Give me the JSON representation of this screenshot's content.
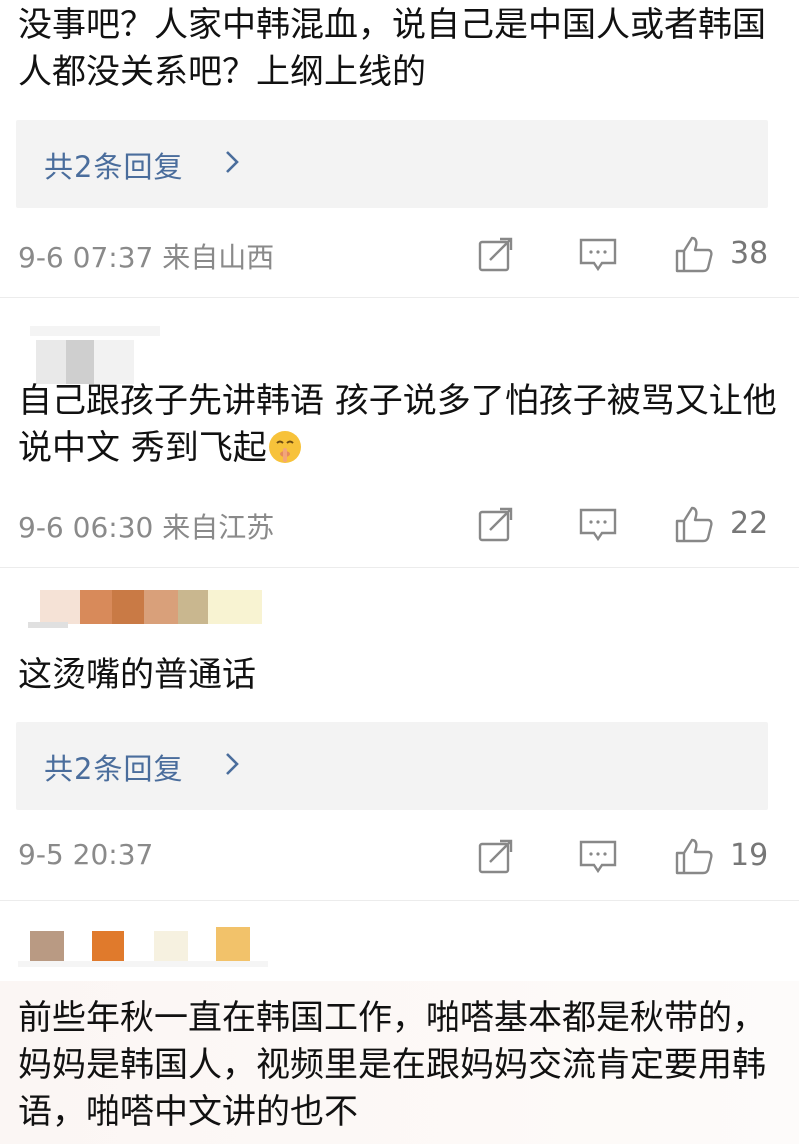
{
  "comments": [
    {
      "text": "没事吧？人家中韩混血，说自己是中国人或者韩国人都没关系吧？上纲上线的",
      "reply_summary": "共2条回复",
      "time": "9-6 07:37",
      "location": "来自山西",
      "likes": "38"
    },
    {
      "text": "自己跟孩子先讲韩语 孩子说多了怕孩子被骂又让他说中文 秀到飞起",
      "emoji": "shushing-face-icon",
      "time": "9-6 06:30",
      "location": "来自江苏",
      "likes": "22"
    },
    {
      "text": "这烫嘴的普通话",
      "reply_summary": "共2条回复",
      "time": "9-5 20:37",
      "location": "",
      "likes": "19"
    },
    {
      "text": "前些年秋一直在韩国工作，啪嗒基本都是秋带的，妈妈是韩国人，视频里是在跟妈妈交流肯定要用韩语，啪嗒中文讲的也不"
    }
  ],
  "icons": {
    "share": "share-icon",
    "reply": "comment-icon",
    "like": "thumbs-up-icon"
  },
  "colors": {
    "reply_link": "#4a6d9c",
    "meta_gray": "#8a8a8a",
    "reply_bg": "#f3f3f3"
  }
}
